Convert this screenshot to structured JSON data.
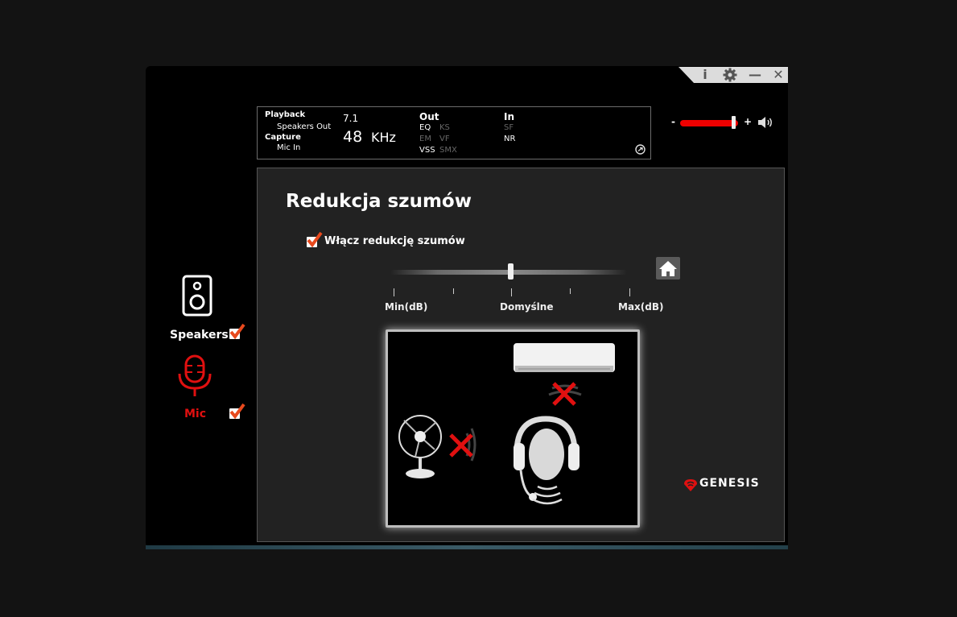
{
  "window": {
    "controls": {
      "info": "i",
      "settings_icon": "gear-icon",
      "minimize": "—",
      "close": "✕"
    }
  },
  "info_panel": {
    "playback": "Playback",
    "speakers_out": "Speakers Out",
    "capture": "Capture",
    "mic_in": "Mic In",
    "channels": "7.1",
    "sample_rate": "48",
    "sample_rate_unit": "KHz",
    "out": {
      "title": "Out",
      "eq": "EQ",
      "ks": "KS",
      "em": "EM",
      "vf": "VF",
      "vss": "VSS",
      "smx": "SMX"
    },
    "in": {
      "title": "In",
      "sf": "SF",
      "nr": "NR"
    }
  },
  "volume": {
    "minus": "-",
    "plus": "+",
    "level": 0.92
  },
  "sidebar": {
    "speakers": {
      "label": "Speakers",
      "checked": true
    },
    "mic": {
      "label": "Mic",
      "checked": true
    }
  },
  "panel": {
    "title": "Redukcja szumów",
    "enable_label": "Włącz redukcję szumów",
    "enable_checked": true,
    "slider": {
      "value_fraction": 0.5,
      "min_label": "Min(dB)",
      "default_label": "Domyślne",
      "max_label": "Max(dB)"
    }
  },
  "brand": "GENESIS",
  "colors": {
    "accent": "#e01010",
    "check": "#e8491d",
    "window_bg": "#000000",
    "panel_bg": "#222222"
  }
}
